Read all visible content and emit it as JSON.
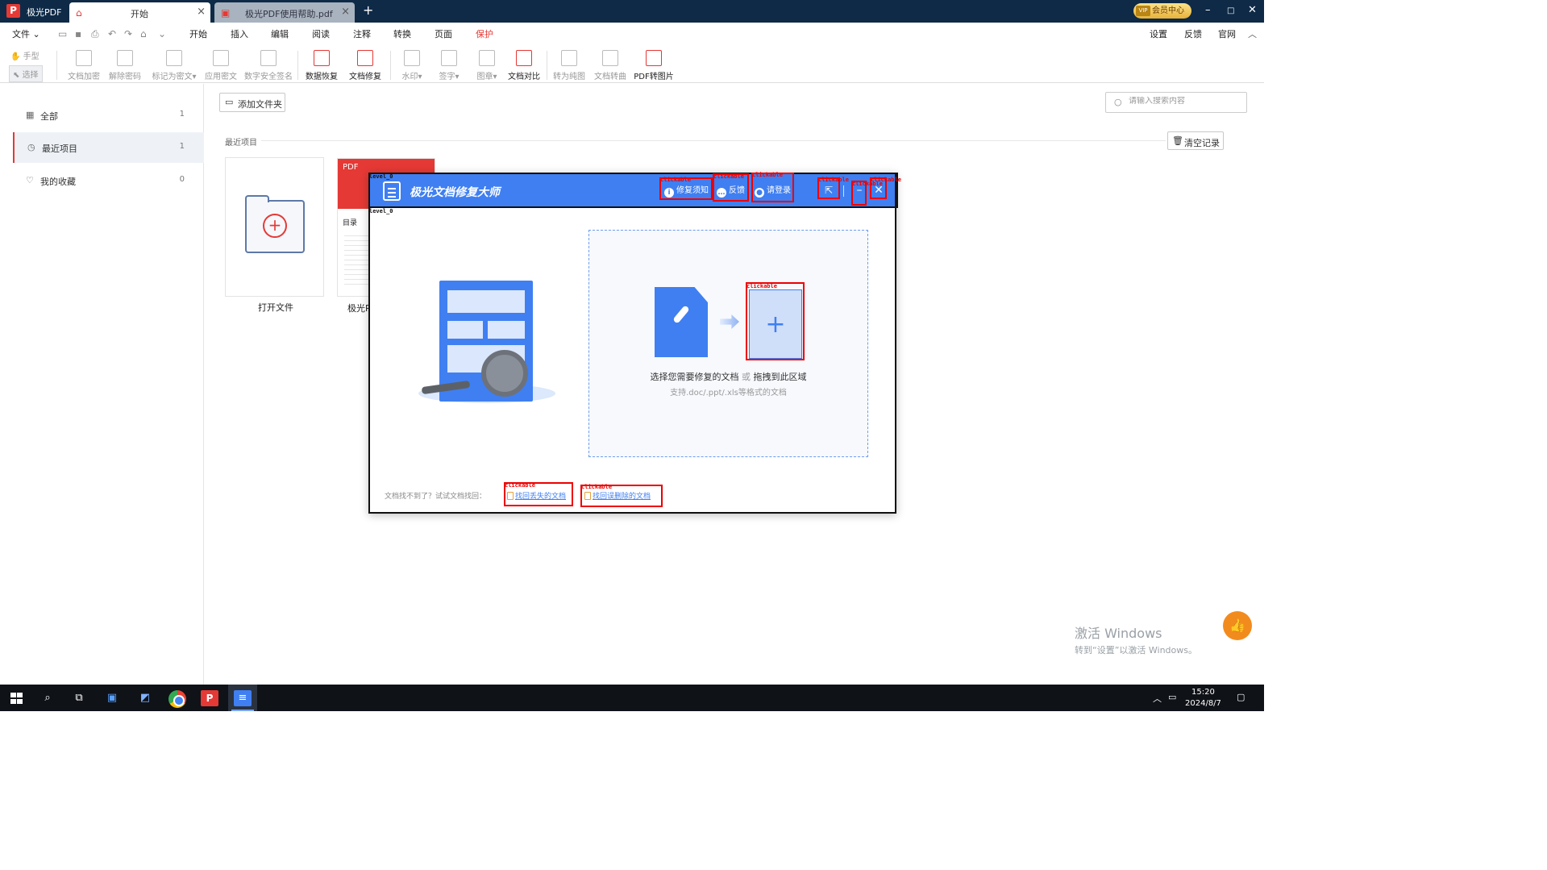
{
  "titlebar": {
    "app_name": "极光PDF",
    "tabs": [
      {
        "label": "开始",
        "icon": "home-icon"
      },
      {
        "label": "极光PDF使用帮助.pdf",
        "icon": "pdf-icon"
      }
    ],
    "vip_label": "会员中心"
  },
  "menubar": {
    "file_label": "文件",
    "menus": [
      "开始",
      "插入",
      "编辑",
      "阅读",
      "注释",
      "转换",
      "页面",
      "保护"
    ],
    "active_menu": "保护",
    "right_links": [
      "设置",
      "反馈",
      "官网"
    ]
  },
  "toolbar": {
    "hand_label": "手型",
    "select_label": "选择",
    "tools": [
      {
        "label": "文档加密",
        "enabled": false
      },
      {
        "label": "解除密码",
        "enabled": false
      },
      {
        "label": "标记为密文",
        "enabled": false,
        "dropdown": true
      },
      {
        "label": "应用密文",
        "enabled": false
      },
      {
        "label": "数字安全签名",
        "enabled": false
      },
      {
        "label": "数据恢复",
        "enabled": true
      },
      {
        "label": "文档修复",
        "enabled": true
      },
      {
        "label": "水印",
        "enabled": false,
        "dropdown": true
      },
      {
        "label": "签字",
        "enabled": false,
        "dropdown": true
      },
      {
        "label": "图章",
        "enabled": false,
        "dropdown": true
      },
      {
        "label": "文档对比",
        "enabled": true
      },
      {
        "label": "转为纯图",
        "enabled": false
      },
      {
        "label": "文档转曲",
        "enabled": false
      },
      {
        "label": "PDF转图片",
        "enabled": true
      }
    ]
  },
  "sidebar": {
    "items": [
      {
        "label": "全部",
        "count": "1",
        "icon": "grid-icon"
      },
      {
        "label": "最近项目",
        "count": "1",
        "icon": "clock-icon"
      },
      {
        "label": "我的收藏",
        "count": "0",
        "icon": "heart-icon"
      }
    ]
  },
  "main": {
    "add_folder_label": "添加文件夹",
    "search_placeholder": "请输入搜索内容",
    "recent_label": "最近项目",
    "clear_label": "清空记录",
    "open_file_label": "打开文件",
    "pdf_card_caption": "极光P",
    "pdf_card_badge": "PDF",
    "pdf_card_toc": "目录"
  },
  "dialog": {
    "title": "极光文档修复大师",
    "header_buttons": [
      "修复须知",
      "反馈",
      "请登录"
    ],
    "drop_main_pre": "选择您需要修复的文档",
    "drop_main_or": "或",
    "drop_main_post": "拖拽到此区域",
    "drop_sub": "支持.doc/.ppt/.xls等格式的文档",
    "recover_label": "文档找不到了？试试文档找回：",
    "recover_links": [
      "找回丢失的文档",
      "找回误删除的文档"
    ]
  },
  "annotations": {
    "clickable": "clickable",
    "level": "level_0"
  },
  "watermark": {
    "line1": "激活 Windows",
    "line2": "转到“设置”以激活 Windows。"
  },
  "taskbar": {
    "time": "15:20",
    "date": "2024/8/7"
  },
  "colors": {
    "brand_red": "#e53935",
    "dialog_blue": "#3f7ff2",
    "titlebar": "#0e2a47"
  }
}
